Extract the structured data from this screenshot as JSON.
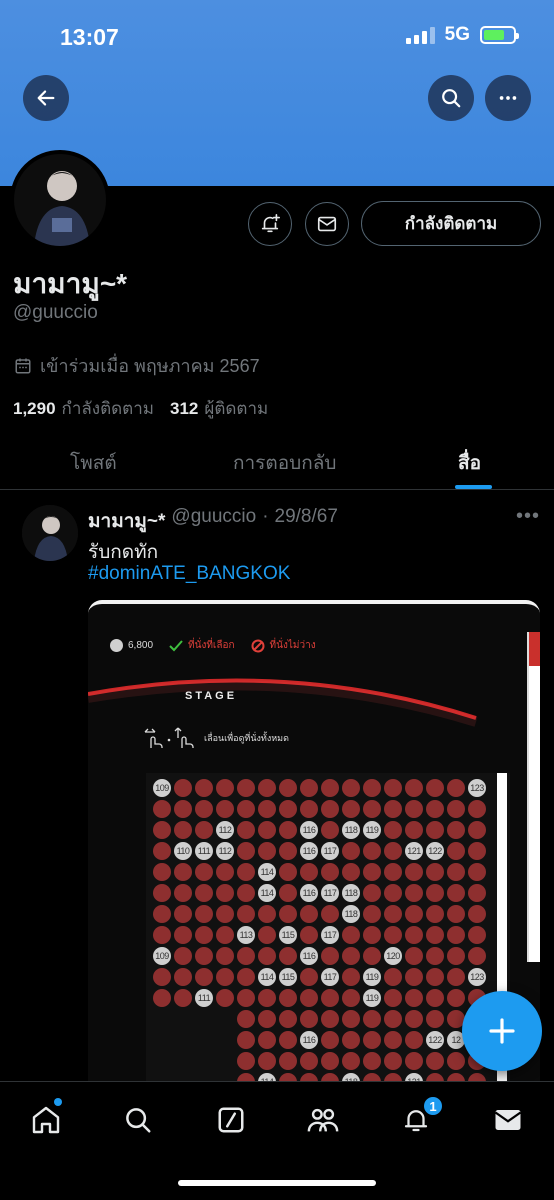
{
  "status_bar": {
    "time": "13:07",
    "network": "5G"
  },
  "header": {
    "back_icon": "arrow-left-icon",
    "search_icon": "search-icon",
    "more_icon": "more-horizontal-icon",
    "banner_color": "#3c86dd"
  },
  "profile": {
    "name": "มามามู~*",
    "handle": "@guuccio",
    "joined": "เข้าร่วมเมื่อ พฤษภาคม 2567",
    "following_count": "1,290",
    "following_label": "กำลังติดตาม",
    "followers_count": "312",
    "followers_label": "ผู้ติดตาม",
    "follow_button": "กำลังติดตาม"
  },
  "tabs": [
    {
      "label": "โพสต์",
      "active": false
    },
    {
      "label": "การตอบกลับ",
      "active": false
    },
    {
      "label": "สื่อ",
      "active": true
    }
  ],
  "post": {
    "name": "มามามู~*",
    "handle": "@guuccio",
    "separator": "·",
    "date": "29/8/67",
    "text": "รับกดทัก",
    "hashtag": "#dominATE_BANGKOK",
    "media": {
      "legend_price": "6,800",
      "legend_selected": "ที่นั่งที่เลือก",
      "legend_unavailable": "ที่นั่งไม่ว่าง",
      "stage": "STAGE",
      "hint": "เลื่อนเพื่อดูที่นั่งทั้งหมด"
    }
  },
  "bottom_nav": {
    "items": [
      "home-icon",
      "search-icon",
      "grok-icon",
      "communities-icon",
      "notifications-icon",
      "messages-icon"
    ],
    "notification_badge": "1"
  },
  "colors": {
    "accent": "#1d9bf0",
    "background": "#000000",
    "seat_taken": "#8e2f2f",
    "seat_free": "#cfcfcf"
  }
}
